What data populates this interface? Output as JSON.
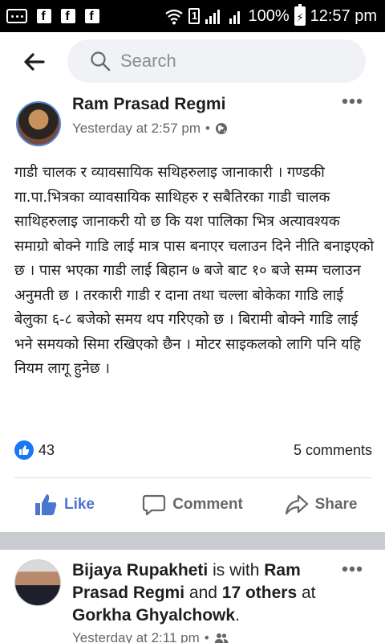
{
  "status_bar": {
    "battery": "100%",
    "time": "12:57 pm",
    "sim": "1"
  },
  "search": {
    "placeholder": "Search"
  },
  "post1": {
    "author": "Ram Prasad Regmi",
    "timestamp": "Yesterday at 2:57 pm",
    "separator": "•",
    "text": "गाडी चालक र व्यावसायिक सथिहरुलाइ जानाकारी । गण्डकी गा.पा.भित्रका व्यावसायिक साथिहरु र सबैतिरका गाडी चालक साथिहरुलाइ जानाकरी यो छ कि यश पालिका भित्र अत्यावश्यक समाग्रो बोक्ने गाडि लाई मात्र पास बनाएर चलाउन दिने नीति बनाइएको छ । पास भएका गाडी लाई बिहान ७ बजे बाट १० बजे सम्म चलाउन अनुमती छ । तरकारी गाडी र दाना तथा चल्ला बोकेका गाडि लाई बेलुका ६-८ बजेको समय थप गरिएको छ । बिरामी बोक्ने गाडि लाई भने समयको सिमा रखिएको छैन । मोटर साइकलको लागि पनि यहि नियम लागू हुनेछ ।",
    "like_count": "43",
    "comments": "5 comments",
    "actions": {
      "like": "Like",
      "comment": "Comment",
      "share": "Share"
    }
  },
  "post2": {
    "author": "Bijaya Rupakheti",
    "is_with": " is with ",
    "tagged": "Ram Prasad Regmi",
    "and": " and ",
    "others": "17 others",
    "at": " at ",
    "place": "Gorkha Ghyalchowk",
    "period": ".",
    "timestamp": "Yesterday at 2:11 pm",
    "separator": "•"
  },
  "colors": {
    "brand_blue": "#1877f2",
    "like_blue": "#4a76d0",
    "muted": "#65676b",
    "separator_gray": "#c9ccd1"
  },
  "icons": [
    "messenger-icon",
    "facebook-icon",
    "wifi-icon",
    "sim-icon",
    "signal-icon",
    "battery-icon",
    "back-arrow-icon",
    "search-icon",
    "more-icon",
    "globe-icon",
    "like-icon",
    "comment-icon",
    "share-icon",
    "friends-icon"
  ]
}
